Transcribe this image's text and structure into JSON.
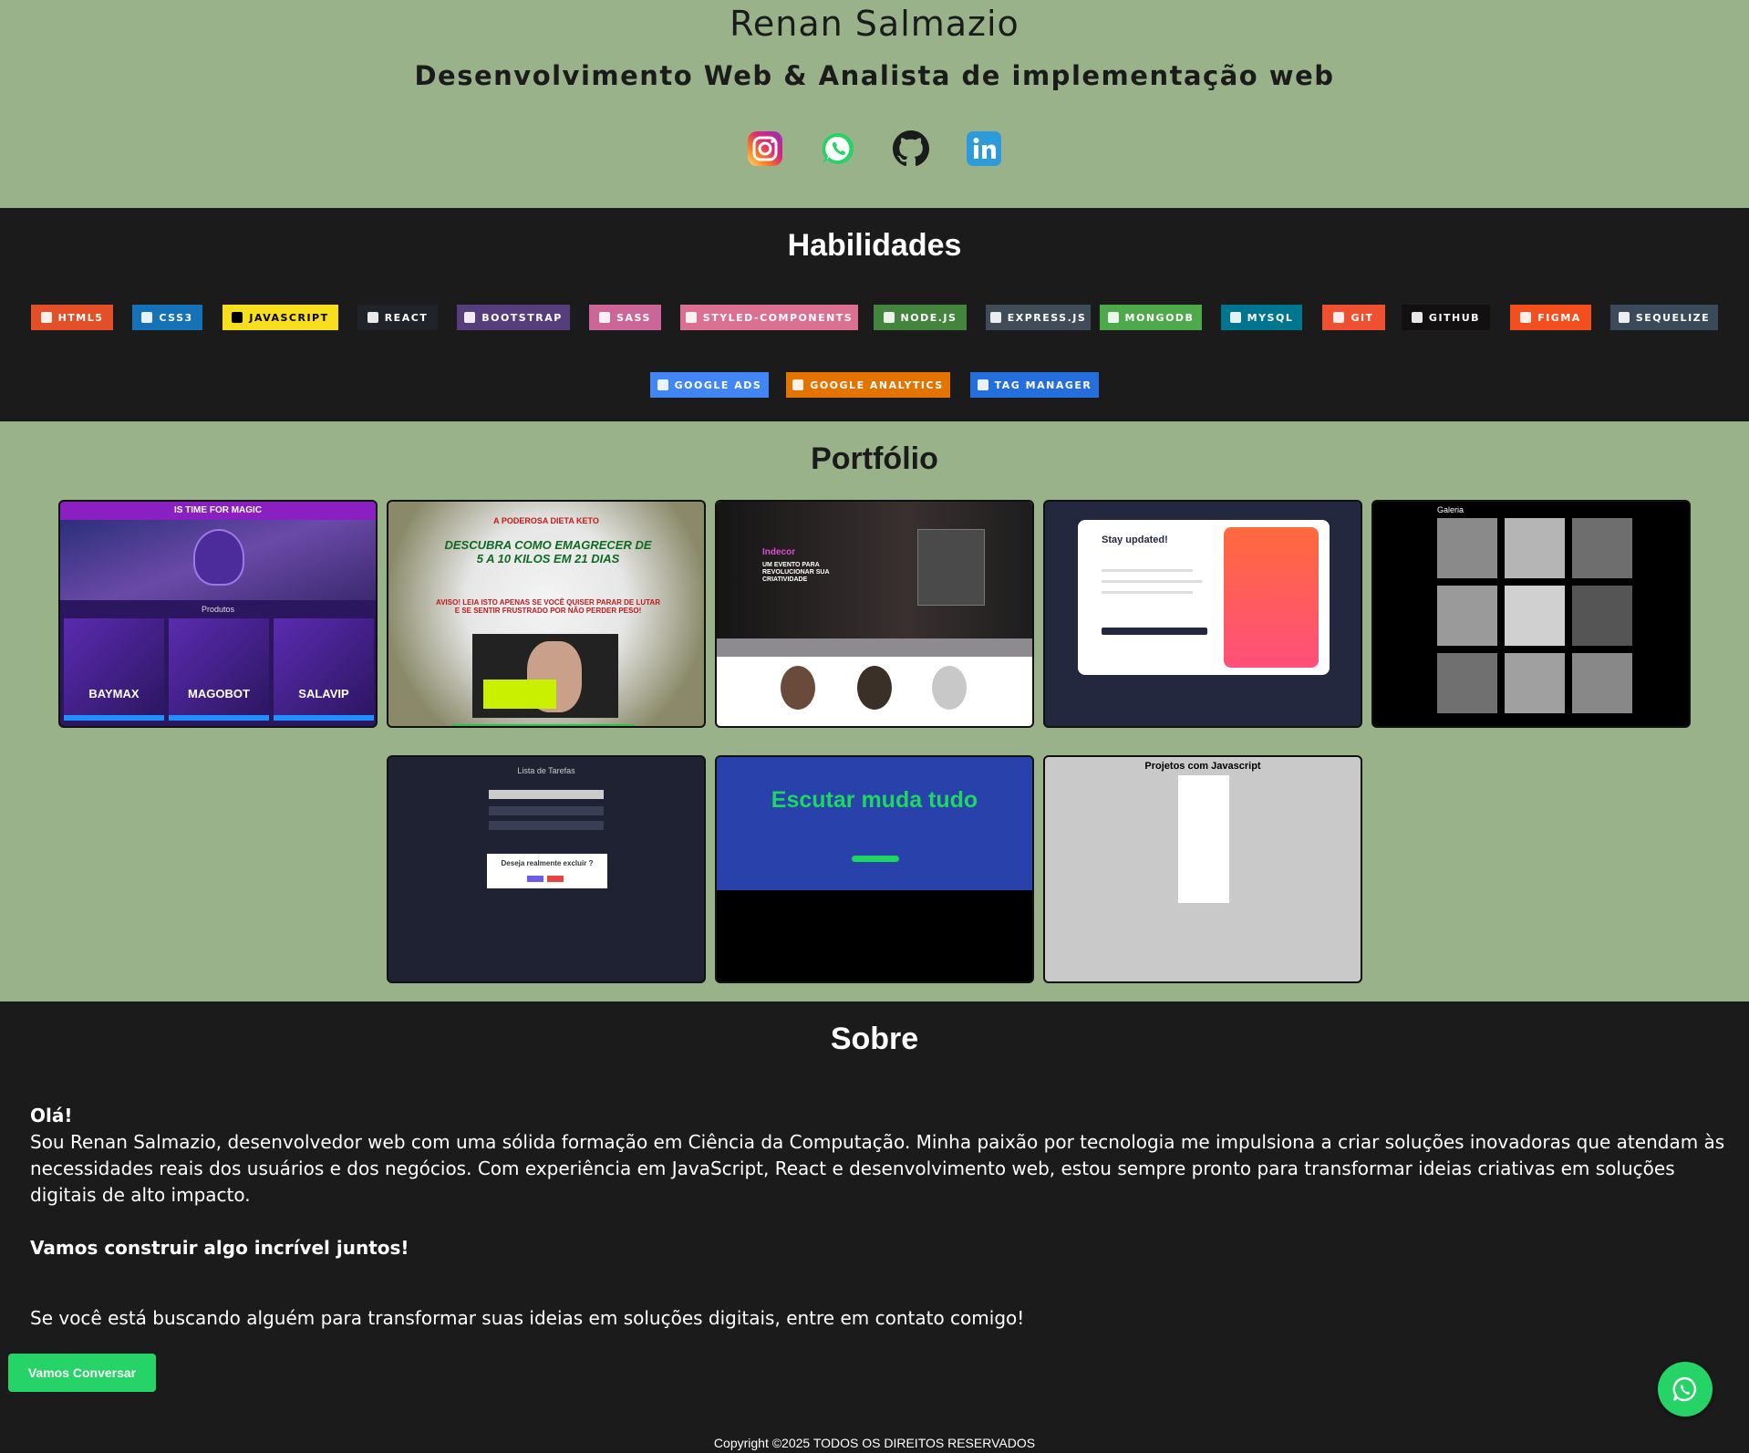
{
  "header": {
    "name": "Renan Salmazio",
    "role": "Desenvolvimento Web & Analista de implementação web",
    "socials": [
      {
        "icon": "instagram-icon",
        "label": "Instagram"
      },
      {
        "icon": "whatsapp-icon",
        "label": "WhatsApp"
      },
      {
        "icon": "github-icon",
        "label": "GitHub"
      },
      {
        "icon": "linkedin-icon",
        "label": "LinkedIn"
      }
    ]
  },
  "skills": {
    "title": "Habilidades",
    "badges": [
      {
        "label": "HTML5",
        "color": "#e34f26"
      },
      {
        "label": "CSS3",
        "color": "#1572b6"
      },
      {
        "label": "JAVASCRIPT",
        "color": "#f7df1e",
        "text_color": "#000000"
      },
      {
        "label": "REACT",
        "color": "#20232a"
      },
      {
        "label": "BOOTSTRAP",
        "color": "#563d7c"
      },
      {
        "label": "SASS",
        "color": "#cc6699"
      },
      {
        "label": "STYLED-COMPONENTS",
        "color": "#db7093"
      },
      {
        "label": "NODE.JS",
        "color": "#43853d"
      },
      {
        "label": "EXPRESS.JS",
        "color": "#404d59"
      },
      {
        "label": "MONGODB",
        "color": "#4ea94b"
      },
      {
        "label": "MYSQL",
        "color": "#00758f"
      },
      {
        "label": "GIT",
        "color": "#f05032"
      },
      {
        "label": "GITHUB",
        "color": "#121011"
      },
      {
        "label": "FIGMA",
        "color": "#f24e1e"
      },
      {
        "label": "SEQUELIZE",
        "color": "#3a4a5a"
      },
      {
        "label": "GOOGLE ADS",
        "color": "#4285f4"
      },
      {
        "label": "GOOGLE ANALYTICS",
        "color": "#e37400"
      },
      {
        "label": "TAG MANAGER",
        "color": "#246fdb"
      }
    ]
  },
  "portfolio": {
    "title": "Portfólio",
    "projects": [
      {
        "name": "mago-dos-bits",
        "thumb_title": "IS TIME FOR MAGIC",
        "thumb_sub": "Produtos",
        "items": [
          "BAYMAX",
          "MAGOBOT",
          "SALAVIP"
        ]
      },
      {
        "name": "dieta-keto",
        "thumb_title": "A PODEROSA DIETA KETO",
        "headline": "DESCUBRA COMO EMAGRECER DE 5 A 10 KILOS EM 21 DIAS",
        "warning": "AVISO! LEIA ISTO APENAS SE VOCÊ QUISER PARAR DE LUTAR E SE SENTIR FRUSTRADO POR NÃO PERDER PESO!"
      },
      {
        "name": "indecor",
        "thumb_title": "Indecor",
        "headline": "UM EVENTO PARA REVOLUCIONAR SUA CRIATIVIDADE"
      },
      {
        "name": "stay-updated",
        "thumb_title": "Stay updated!"
      },
      {
        "name": "galeria",
        "thumb_title": "Galeria"
      },
      {
        "name": "lista-de-tarefas",
        "thumb_title": "Lista de Tarefas",
        "dialog": "Deseja realmente excluir ?"
      },
      {
        "name": "spotify",
        "headline": "Escutar muda tudo"
      },
      {
        "name": "projetos-javascript",
        "thumb_title": "Projetos com Javascript"
      }
    ]
  },
  "sobre": {
    "title": "Sobre",
    "greeting": "Olá!",
    "intro": "Sou Renan Salmazio, desenvolvedor web com uma sólida formação em Ciência da Computação. Minha paixão por tecnologia me impulsiona a criar soluções inovadoras que atendam às necessidades reais dos usuários e dos negócios. Com experiência em JavaScript, React e desenvolvimento web, estou sempre pronto para transformar ideias criativas em soluções digitais de alto impacto.",
    "tagline": "Vamos construir algo incrível juntos!",
    "contact": "Se você está buscando alguém para transformar suas ideias em soluções digitais, entre em contato comigo!",
    "cta": "Vamos Conversar"
  },
  "footer": {
    "copyright": "Copyright ©2025 TODOS OS DIREITOS RESERVADOS"
  },
  "colors": {
    "sage": "#9ab28a",
    "dark": "#1b1b1c",
    "whatsapp": "#25d366"
  }
}
